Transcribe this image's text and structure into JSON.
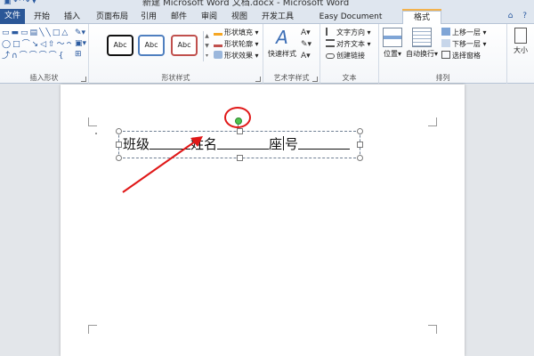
{
  "window": {
    "title": "新建 Microsoft Word 文档.docx - Microsoft Word"
  },
  "tabs": {
    "file": "文件",
    "items": [
      "开始",
      "插入",
      "页面布局",
      "引用",
      "邮件",
      "审阅",
      "视图",
      "开发工具",
      "Easy Document Creator",
      "格式"
    ],
    "active": "格式"
  },
  "ribbon": {
    "insert_shapes": {
      "label": "插入形状"
    },
    "shape_styles": {
      "label": "形状样式",
      "gallery": [
        "Abc",
        "Abc",
        "Abc"
      ],
      "fill": "形状填充",
      "outline": "形状轮廓",
      "effects": "形状效果"
    },
    "wordart": {
      "label": "艺术字样式",
      "quick_styles": "快速样式"
    },
    "text": {
      "label": "文本",
      "direction": "文字方向",
      "align": "对齐文本",
      "link": "创建链接"
    },
    "arrange": {
      "label": "排列",
      "position": "位置",
      "wrap": "自动换行",
      "bring_forward": "上移一层",
      "send_backward": "下移一层",
      "selection_pane": "选择窗格"
    },
    "size": {
      "label": "大小"
    }
  },
  "document": {
    "textbox": {
      "class_label": "班级",
      "name_label": "姓名",
      "seat_label_a": "座",
      "seat_label_b": "号"
    }
  },
  "colors": {
    "file_tab": "#2b5797",
    "annotation": "#e01818",
    "rotation_handle": "#4ec24e"
  }
}
